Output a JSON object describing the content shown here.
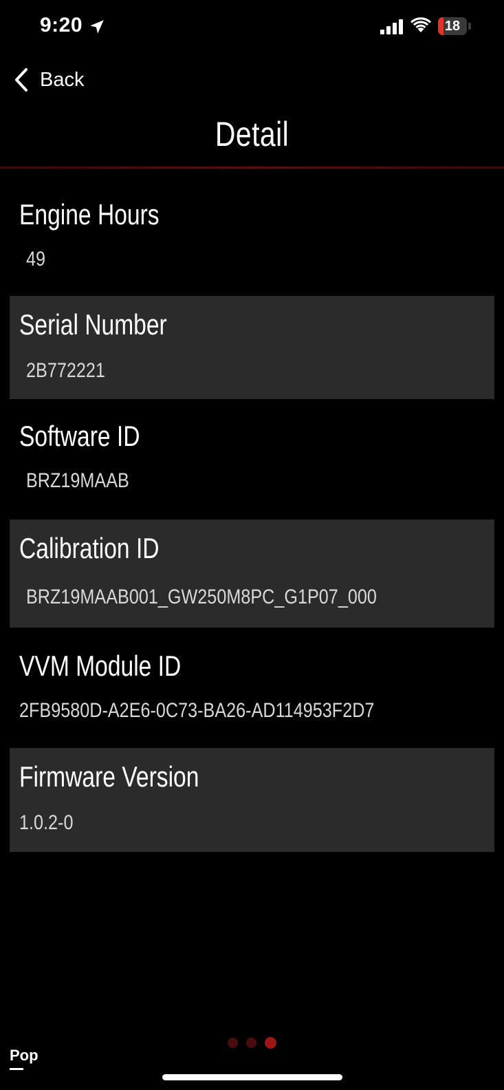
{
  "status_bar": {
    "time": "9:20",
    "battery_level": "18",
    "battery_fraction": 0.18,
    "location_icon": "location-arrow-icon",
    "signal_icon": "cellular-signal-icon",
    "wifi_icon": "wifi-icon"
  },
  "nav": {
    "back_label": "Back",
    "back_icon": "chevron-left-icon",
    "title": "Detail"
  },
  "details": [
    {
      "label": "Engine Hours",
      "value": "49"
    },
    {
      "label": "Serial Number",
      "value": "2B772221"
    },
    {
      "label": "Software ID",
      "value": "BRZ19MAAB"
    },
    {
      "label": "Calibration ID",
      "value": "BRZ19MAAB001_GW250M8PC_G1P07_000"
    },
    {
      "label": "VVM Module ID",
      "value": "2FB9580D-A2E6-0C73-BA26-AD114953F2D7"
    },
    {
      "label": "Firmware Version",
      "value": "1.0.2-0"
    }
  ],
  "pager": {
    "count": 3,
    "active_index": 2
  },
  "footer": {
    "pop_label": "Pop"
  },
  "colors": {
    "background": "#000000",
    "row_shade": "#2b2b2b",
    "accent_red": "#9e1515",
    "divider_red": "#5a0e0e",
    "battery_red": "#e0342b"
  }
}
